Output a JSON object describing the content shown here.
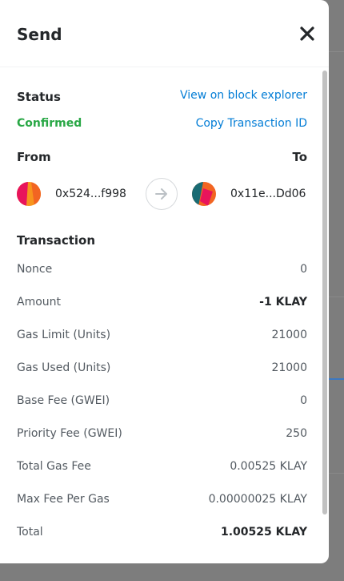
{
  "header": {
    "title": "Send"
  },
  "status": {
    "label": "Status",
    "value": "Confirmed",
    "view_link": "View on block explorer",
    "copy_link": "Copy Transaction ID"
  },
  "parties": {
    "from_label": "From",
    "to_label": "To",
    "from_address": "0x524...f998",
    "to_address": "0x11e...Dd06"
  },
  "transaction": {
    "heading": "Transaction",
    "rows": [
      {
        "label": "Nonce",
        "value": "0"
      },
      {
        "label": "Amount",
        "value": "-1 KLAY"
      },
      {
        "label": "Gas Limit (Units)",
        "value": "21000"
      },
      {
        "label": "Gas Used (Units)",
        "value": "21000"
      },
      {
        "label": "Base Fee (GWEI)",
        "value": "0"
      },
      {
        "label": "Priority Fee (GWEI)",
        "value": "250"
      },
      {
        "label": "Total Gas Fee",
        "value": "0.00525 KLAY"
      },
      {
        "label": "Max Fee Per Gas",
        "value": "0.00000025 KLAY"
      },
      {
        "label": "Total",
        "value": "1.00525 KLAY"
      }
    ]
  },
  "colors": {
    "confirmed": "#28a745",
    "link": "#037dd6"
  }
}
